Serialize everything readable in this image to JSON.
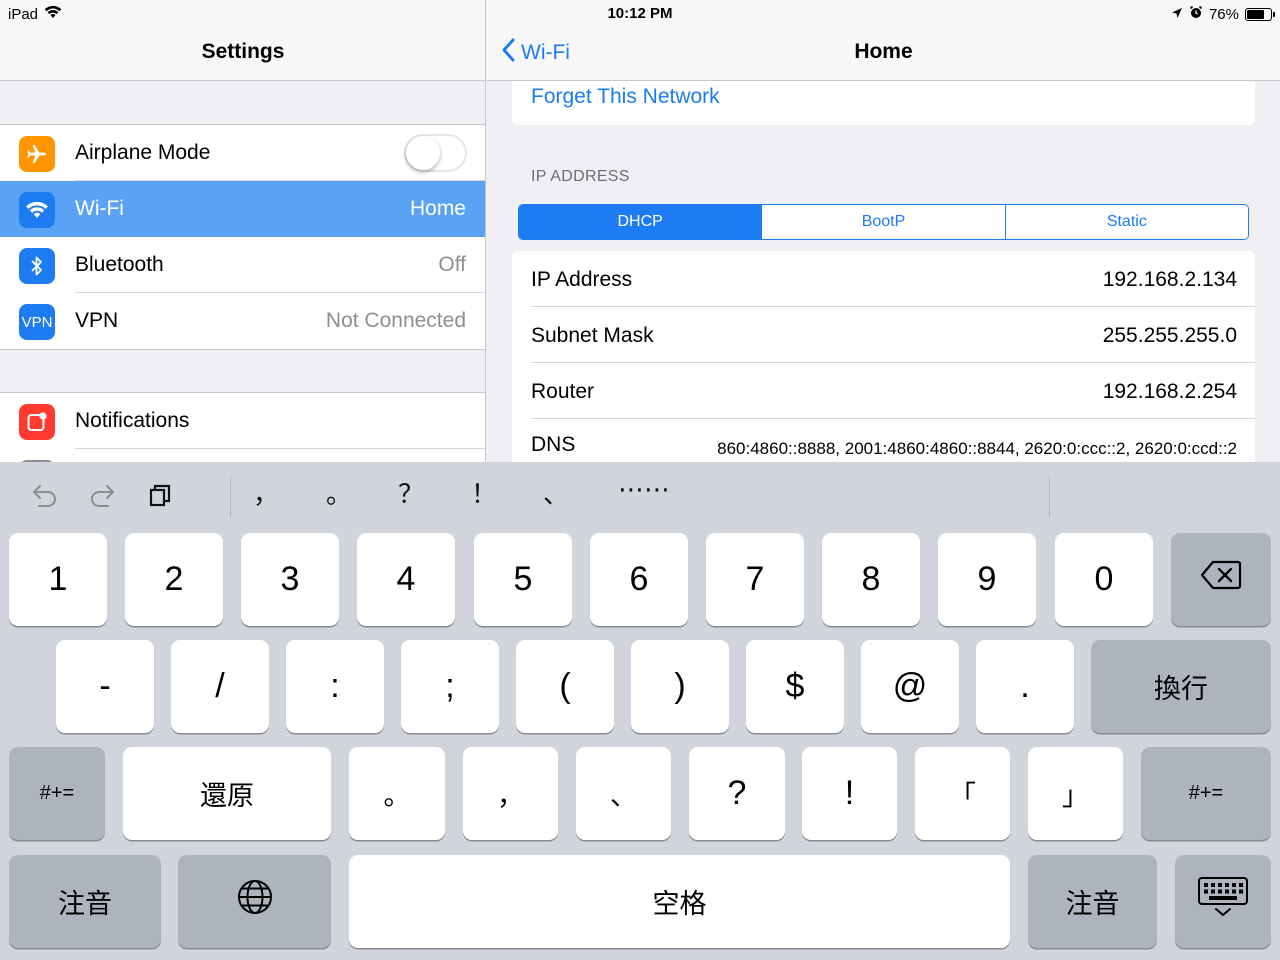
{
  "status_bar": {
    "device": "iPad",
    "time": "10:12 PM",
    "battery": "76%",
    "battery_fraction": 0.76
  },
  "left": {
    "title": "Settings",
    "items": [
      {
        "label": "Airplane Mode",
        "value": "",
        "icon": "airplane-icon",
        "color": "#ff9500",
        "toggle_on": false
      },
      {
        "label": "Wi-Fi",
        "value": "Home",
        "icon": "wifi-icon",
        "color": "#1e7cf2",
        "selected": true
      },
      {
        "label": "Bluetooth",
        "value": "Off",
        "icon": "bluetooth-icon",
        "color": "#1e7cf2"
      },
      {
        "label": "VPN",
        "value": "Not Connected",
        "icon": "vpn-icon",
        "icon_text": "VPN",
        "color": "#1e7cf2"
      }
    ],
    "items2": [
      {
        "label": "Notifications",
        "icon": "notifications-icon",
        "color": "#ff3b30"
      }
    ]
  },
  "right": {
    "back_label": "Wi-Fi",
    "title": "Home",
    "forget_label": "Forget This Network",
    "section_label": "IP ADDRESS",
    "segments": [
      "DHCP",
      "BootP",
      "Static"
    ],
    "selected_segment": "DHCP",
    "rows": [
      {
        "key": "IP Address",
        "value": "192.168.2.134"
      },
      {
        "key": "Subnet Mask",
        "value": "255.255.255.0"
      },
      {
        "key": "Router",
        "value": "192.168.2.254"
      },
      {
        "key": "DNS",
        "value": "860:4860::8888, 2001:4860:4860::8844, 2620:0:ccc::2, 2620:0:ccd::2"
      }
    ]
  },
  "keyboard": {
    "candidates": [
      "，",
      "。",
      "？",
      "！",
      "、",
      "⋯⋯"
    ],
    "row1": [
      "1",
      "2",
      "3",
      "4",
      "5",
      "6",
      "7",
      "8",
      "9",
      "0"
    ],
    "row2": [
      "-",
      "/",
      ":",
      ";",
      "(",
      ")",
      "$",
      "@",
      "."
    ],
    "return_label": "換行",
    "row3_left": "#+=",
    "undo_label": "還原",
    "row3": [
      "。",
      "，",
      "、",
      "?",
      "!",
      "「",
      "」"
    ],
    "row3_right": "#+=",
    "zhuyin_left": "注音",
    "space_label": "空格",
    "zhuyin_right": "注音"
  }
}
